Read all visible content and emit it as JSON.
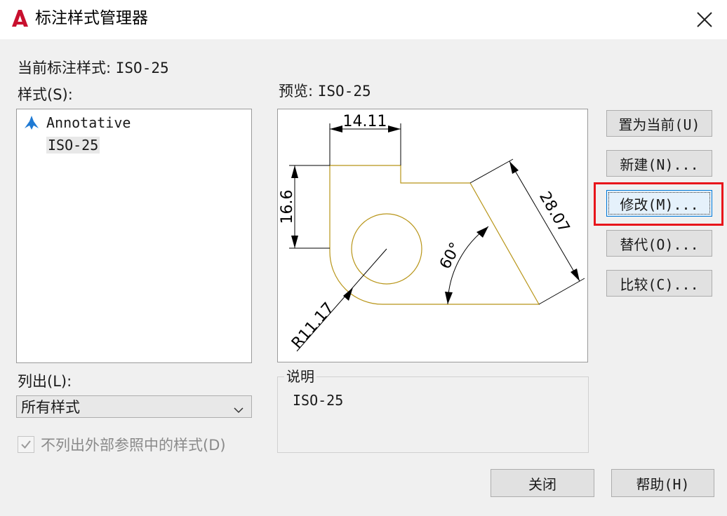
{
  "window": {
    "title": "标注样式管理器",
    "logo_letter": "A",
    "accent": "#c8102e"
  },
  "current_style": {
    "label": "当前标注样式:",
    "value": "ISO-25"
  },
  "styles": {
    "label": "样式(S):",
    "items": [
      {
        "name": "Annotative",
        "icon": "annotative-icon",
        "selected": false
      },
      {
        "name": "ISO-25",
        "icon": "",
        "selected": true
      }
    ]
  },
  "preview": {
    "label": "预览:",
    "value": "ISO-25",
    "dimension_texts": {
      "horizontal": "14.11",
      "vertical": "16.6",
      "aligned": "28.07",
      "angle": "60°",
      "radius": "R11.17"
    }
  },
  "list_filter": {
    "label": "列出(L):",
    "selected": "所有样式"
  },
  "exclude_xref": {
    "label": "不列出外部参照中的样式(D)",
    "checked": true,
    "disabled": true
  },
  "description": {
    "legend": "说明",
    "value": "ISO-25"
  },
  "buttons": {
    "set_current": "置为当前(U)",
    "new": "新建(N)...",
    "modify": "修改(M)...",
    "override": "替代(O)...",
    "compare": "比较(C)...",
    "close": "关闭",
    "help": "帮助(H)"
  },
  "colors": {
    "geometry": "#b89518",
    "dimension": "#000000",
    "highlight_box": "#e8151b"
  }
}
